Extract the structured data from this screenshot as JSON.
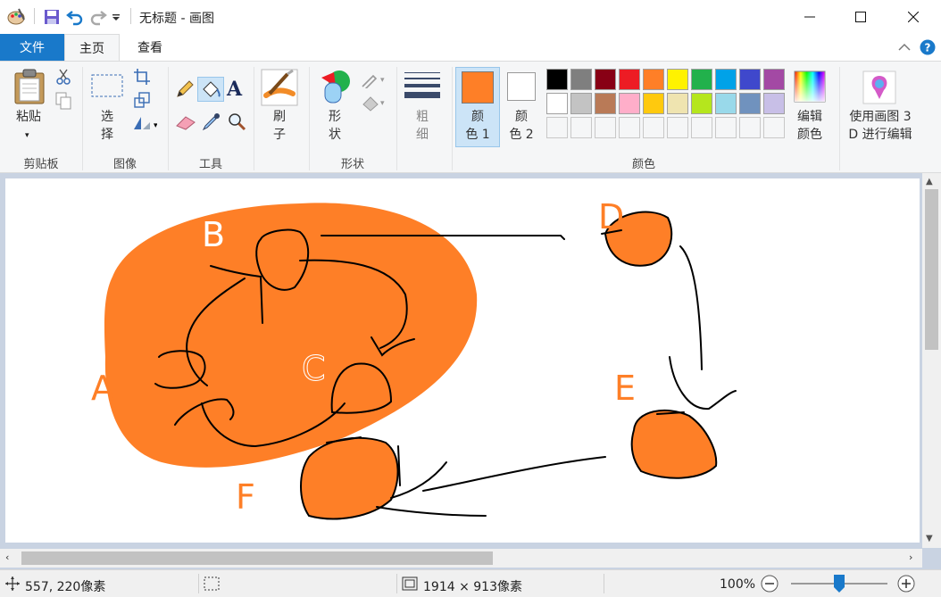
{
  "window": {
    "title": "无标题 - 画图",
    "minimize_icon": "minimize-icon",
    "maximize_icon": "maximize-icon",
    "close_icon": "close-icon"
  },
  "quick_access": {
    "app_icon": "paint-palette-icon",
    "save_icon": "save-icon",
    "undo_icon": "undo-icon",
    "redo_icon": "redo-icon",
    "customize_icon": "dropdown-caret-icon"
  },
  "tabs": {
    "file": "文件",
    "home": "主页",
    "view": "查看"
  },
  "ribbon": {
    "clipboard": {
      "paste": "粘贴",
      "group": "剪贴板"
    },
    "image": {
      "select": "选\n择",
      "group": "图像"
    },
    "tools": {
      "text_glyph": "A",
      "group": "工具"
    },
    "brushes": {
      "label": "刷\n子",
      "group": ""
    },
    "shapes": {
      "label": "形\n状",
      "group": "形状"
    },
    "size": {
      "label": "粗\n细"
    },
    "color1": {
      "label": "颜\n色 1",
      "value": "#fe7f27"
    },
    "color2": {
      "label": "颜\n色 2",
      "value": "#ffffff"
    },
    "palette_row1": [
      "#000000",
      "#7f7f7f",
      "#880015",
      "#ed1c24",
      "#ff7f27",
      "#fff200",
      "#22b14c",
      "#00a2e8",
      "#3f48cc",
      "#a349a4"
    ],
    "palette_row2": [
      "#ffffff",
      "#c3c3c3",
      "#b97a57",
      "#ffaec9",
      "#ffc90e",
      "#efe4b0",
      "#b5e61d",
      "#99d9ea",
      "#7092be",
      "#c8bfe7"
    ],
    "colors_group": "颜色",
    "edit_colors": "编辑\n颜色",
    "paint3d": "使用画图 3\nD 进行编辑"
  },
  "canvas_labels": {
    "a": "A",
    "b": "B",
    "c": "C",
    "d": "D",
    "e": "E",
    "f": "F"
  },
  "accent_orange": "#fe7f27",
  "status": {
    "cursor_pos": "557, 220像素",
    "selection_size": "",
    "image_size": "1914 × 913像素",
    "zoom": "100%",
    "zoom_level": 0.5
  }
}
